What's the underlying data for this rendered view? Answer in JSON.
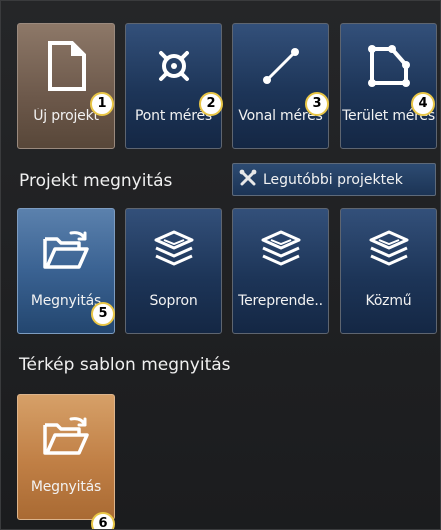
{
  "top_row": [
    {
      "label": "Új projekt",
      "icon": "new-document-icon",
      "badge": "1"
    },
    {
      "label": "Pont mérés",
      "icon": "point-target-icon",
      "badge": "2"
    },
    {
      "label": "Vonal mérés",
      "icon": "line-segment-icon",
      "badge": "3"
    },
    {
      "label": "Terület mérés",
      "icon": "area-polygon-icon",
      "badge": "4"
    }
  ],
  "project_open": {
    "title": "Projekt megnyitás",
    "recent_button": "Legutóbbi projektek",
    "tiles": [
      {
        "label": "Megnyitás",
        "icon": "open-folder-icon",
        "badge": "5"
      },
      {
        "label": "Sopron",
        "icon": "layers-icon"
      },
      {
        "label": "Tereprende..",
        "icon": "layers-icon"
      },
      {
        "label": "Közmű",
        "icon": "layers-icon"
      }
    ]
  },
  "template_open": {
    "title": "Térkép sablon megnyitás",
    "tile": {
      "label": "Megnyitás",
      "icon": "open-folder-icon",
      "badge": "6"
    }
  },
  "colors": {
    "tile_blue": "#1d3558",
    "tile_brown": "#6c584a",
    "tile_orange": "#c07f45",
    "badge_border": "#e9c646"
  }
}
